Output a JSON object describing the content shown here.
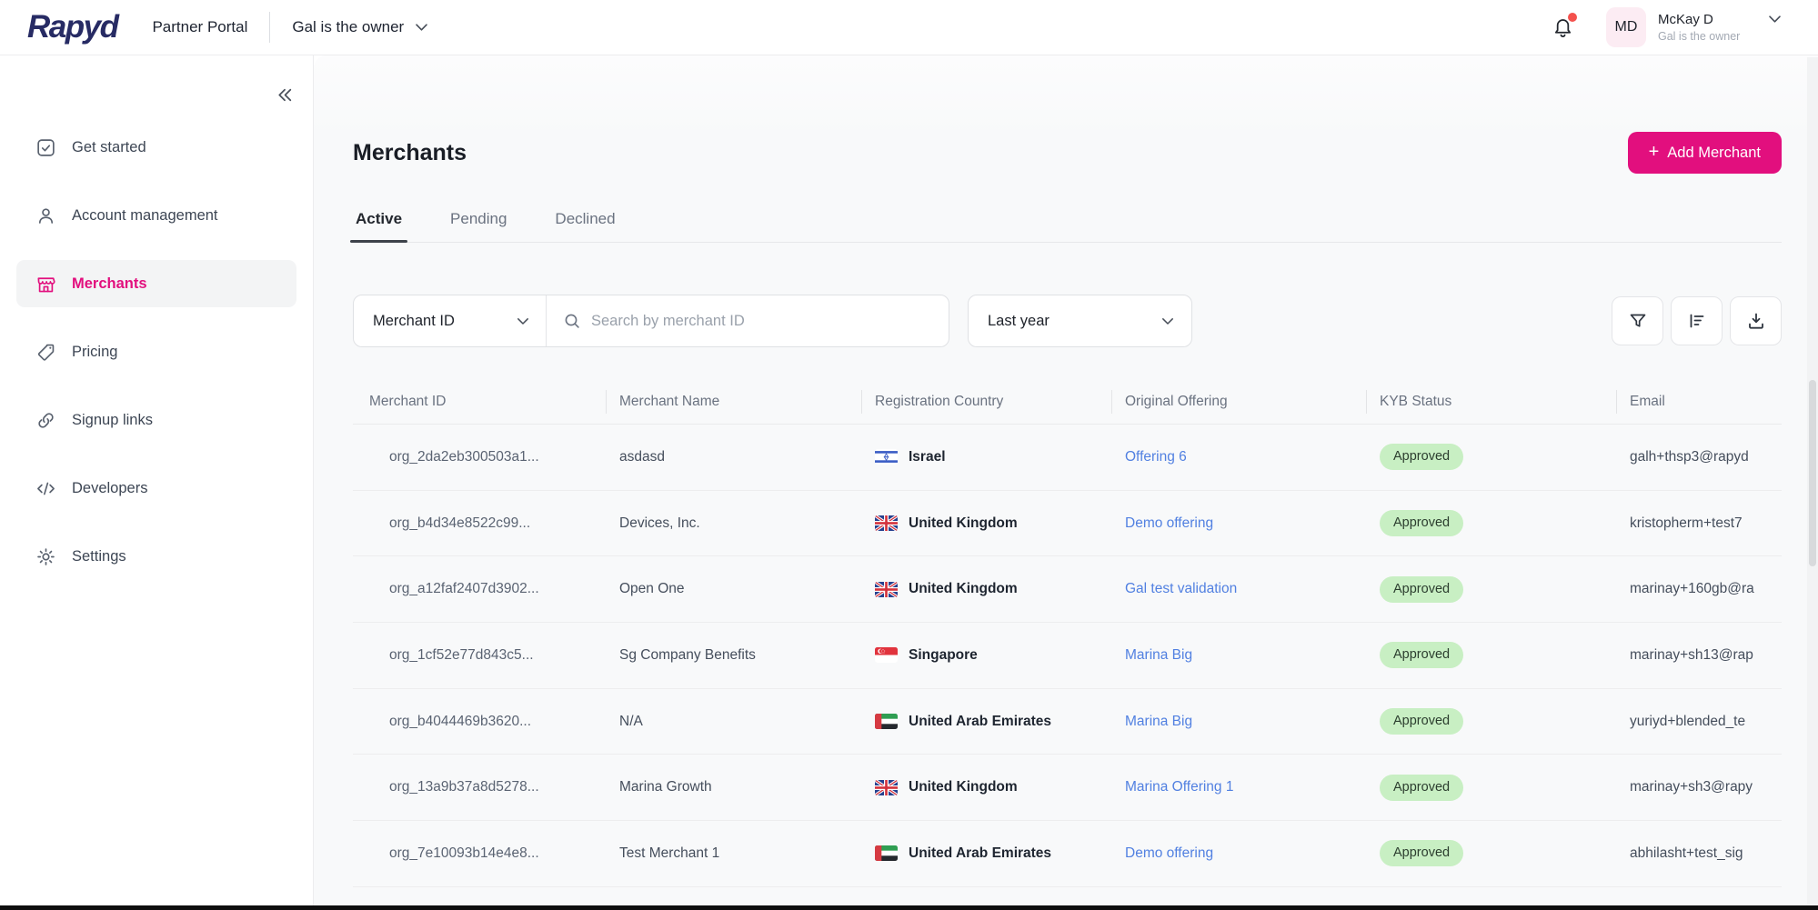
{
  "header": {
    "logo": "Rapyd",
    "app_title": "Partner Portal",
    "workspace_selector": "Gal is the owner",
    "notifications": {
      "has_unread": true
    },
    "user": {
      "initials": "MD",
      "name": "McKay D",
      "role": "Gal is the owner"
    }
  },
  "sidebar": {
    "items": [
      {
        "label": "Get started",
        "icon": "checkbox",
        "active": false
      },
      {
        "label": "Account management",
        "icon": "person",
        "active": false
      },
      {
        "label": "Merchants",
        "icon": "store",
        "active": true
      },
      {
        "label": "Pricing",
        "icon": "tag",
        "active": false
      },
      {
        "label": "Signup links",
        "icon": "link",
        "active": false
      },
      {
        "label": "Developers",
        "icon": "code",
        "active": false
      },
      {
        "label": "Settings",
        "icon": "gear",
        "active": false
      }
    ]
  },
  "main": {
    "title": "Merchants",
    "add_button": {
      "plus": "+",
      "label": "Add Merchant"
    },
    "tabs": [
      {
        "label": "Active",
        "active": true
      },
      {
        "label": "Pending",
        "active": false
      },
      {
        "label": "Declined",
        "active": false
      }
    ],
    "filters": {
      "field_selector": "Merchant ID",
      "search_placeholder": "Search by merchant ID",
      "date_range": "Last year"
    },
    "toolbar_icons": [
      "filter-icon",
      "sort-icon",
      "download-icon"
    ],
    "table": {
      "columns": [
        "Merchant ID",
        "Merchant Name",
        "Registration Country",
        "Original Offering",
        "KYB Status",
        "Email"
      ],
      "rows": [
        {
          "merchant_id": "org_2da2eb300503a1...",
          "merchant_name": "asdasd",
          "country": "Israel",
          "flag": "il",
          "offering": "Offering 6",
          "kyb_status": "Approved",
          "email": "galh+thsp3@rapyd"
        },
        {
          "merchant_id": "org_b4d34e8522c99...",
          "merchant_name": "Devices, Inc.",
          "country": "United Kingdom",
          "flag": "gb",
          "offering": "Demo offering",
          "kyb_status": "Approved",
          "email": "kristopherm+test7"
        },
        {
          "merchant_id": "org_a12faf2407d3902...",
          "merchant_name": "Open One",
          "country": "United Kingdom",
          "flag": "gb",
          "offering": "Gal test validation",
          "kyb_status": "Approved",
          "email": "marinay+160gb@ra"
        },
        {
          "merchant_id": "org_1cf52e77d843c5...",
          "merchant_name": "Sg Company Benefits",
          "country": "Singapore",
          "flag": "sg",
          "offering": "Marina Big",
          "kyb_status": "Approved",
          "email": "marinay+sh13@rap"
        },
        {
          "merchant_id": "org_b4044469b3620...",
          "merchant_name": "N/A",
          "country": "United Arab Emirates",
          "flag": "ae",
          "offering": "Marina Big",
          "kyb_status": "Approved",
          "email": "yuriyd+blended_te"
        },
        {
          "merchant_id": "org_13a9b37a8d5278...",
          "merchant_name": "Marina Growth",
          "country": "United Kingdom",
          "flag": "gb",
          "offering": "Marina Offering 1",
          "kyb_status": "Approved",
          "email": "marinay+sh3@rapy"
        },
        {
          "merchant_id": "org_7e10093b14e4e8...",
          "merchant_name": "Test Merchant 1",
          "country": "United Arab Emirates",
          "flag": "ae",
          "offering": "Demo offering",
          "kyb_status": "Approved",
          "email": "abhilasht+test_sig"
        }
      ]
    }
  },
  "colors": {
    "brand_pink": "#e20f7e",
    "brand_navy": "#272b64",
    "link_blue": "#5180e1",
    "badge_green_bg": "#c8efc3",
    "badge_green_text": "#2c3e2f",
    "notification_dot": "#f4514d"
  }
}
